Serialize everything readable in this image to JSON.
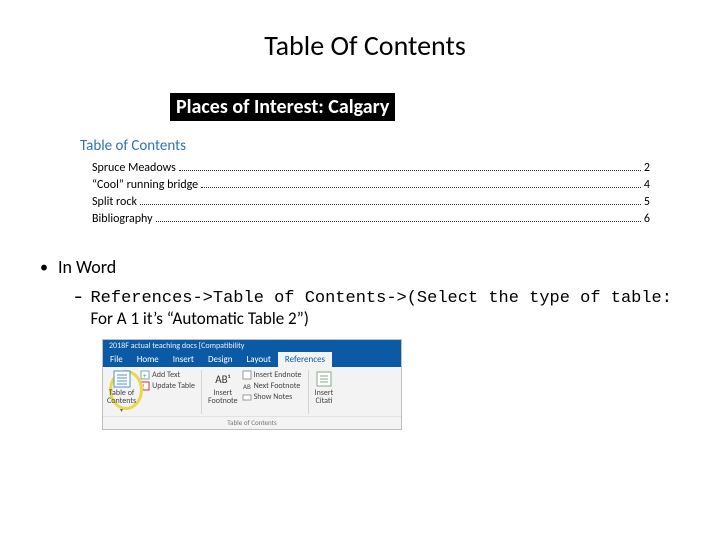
{
  "title": "Table Of Contents",
  "doc": {
    "heading": "Places of Interest: Calgary",
    "tocHeading": "Table of Contents",
    "entries": [
      {
        "label": "Spruce Meadows",
        "page": "2"
      },
      {
        "label": "“Cool” running bridge",
        "page": "4"
      },
      {
        "label": "Split rock",
        "page": "5"
      },
      {
        "label": "Bibliography",
        "page": "6"
      }
    ]
  },
  "bullets": {
    "l1": "In Word",
    "l2_mono": "References->Table of Contents->(Select the type of table:",
    "l2_tail": " For A 1 it’s “Automatic Table 2”)"
  },
  "ribbon": {
    "titlebar": "2018F actual teaching docs [Compatibility",
    "tabs": {
      "file": "File",
      "home": "Home",
      "insert": "Insert",
      "design": "Design",
      "layout": "Layout",
      "references": "References"
    },
    "groupToc": {
      "button": "Table of\nContents",
      "addText": "Add Text",
      "updateTable": "Update Table",
      "caption": "Table of Contents"
    },
    "groupFoot": {
      "button": "AB¹",
      "buttonLabel": "Insert\nFootnote",
      "endnote": "Insert Endnote",
      "next": "Next Footnote",
      "show": "Show Notes"
    },
    "groupCite": {
      "button": "Insert\nCitati"
    }
  }
}
